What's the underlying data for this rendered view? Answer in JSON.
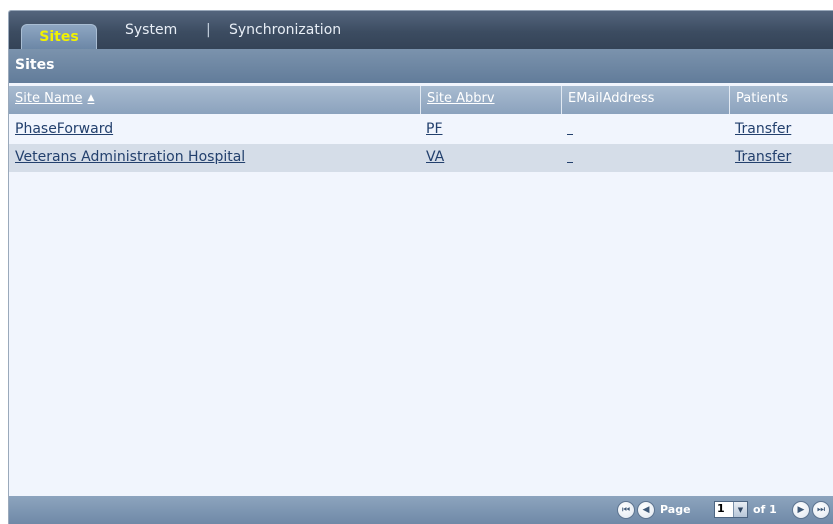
{
  "tabs": [
    {
      "label": "Sites",
      "active": true
    },
    {
      "label": "System",
      "active": false
    },
    {
      "label": "Synchronization",
      "active": false
    }
  ],
  "tab_separator": "|",
  "panel_title": "Sites",
  "table": {
    "columns": [
      {
        "label": "Site Name",
        "sortable": true,
        "sorted": "ascending"
      },
      {
        "label": "Site Abbrv",
        "sortable": true
      },
      {
        "label": "EMailAddress",
        "sortable": false
      },
      {
        "label": "Patients",
        "sortable": false
      }
    ],
    "rows": [
      {
        "site_name": "PhaseForward",
        "site_abbrv": "PF",
        "email": "",
        "patients": "Transfer"
      },
      {
        "site_name": "Veterans Administration Hospital",
        "site_abbrv": "VA",
        "email": "",
        "patients": "Transfer"
      }
    ]
  },
  "pager": {
    "page_label": "Page",
    "current_page": "1",
    "of_label": "of 1"
  },
  "colors": {
    "active_tab_text": "#f2f200",
    "link_text": "#23406d",
    "tab_bar": "#3c4c61",
    "alt_row": "#d5dde8"
  },
  "icons": {
    "first": "first-page-icon",
    "prev": "previous-page-icon",
    "next": "next-page-icon",
    "last": "last-page-icon",
    "sort": "sort-ascending-icon",
    "dropdown": "dropdown-arrow-icon"
  }
}
